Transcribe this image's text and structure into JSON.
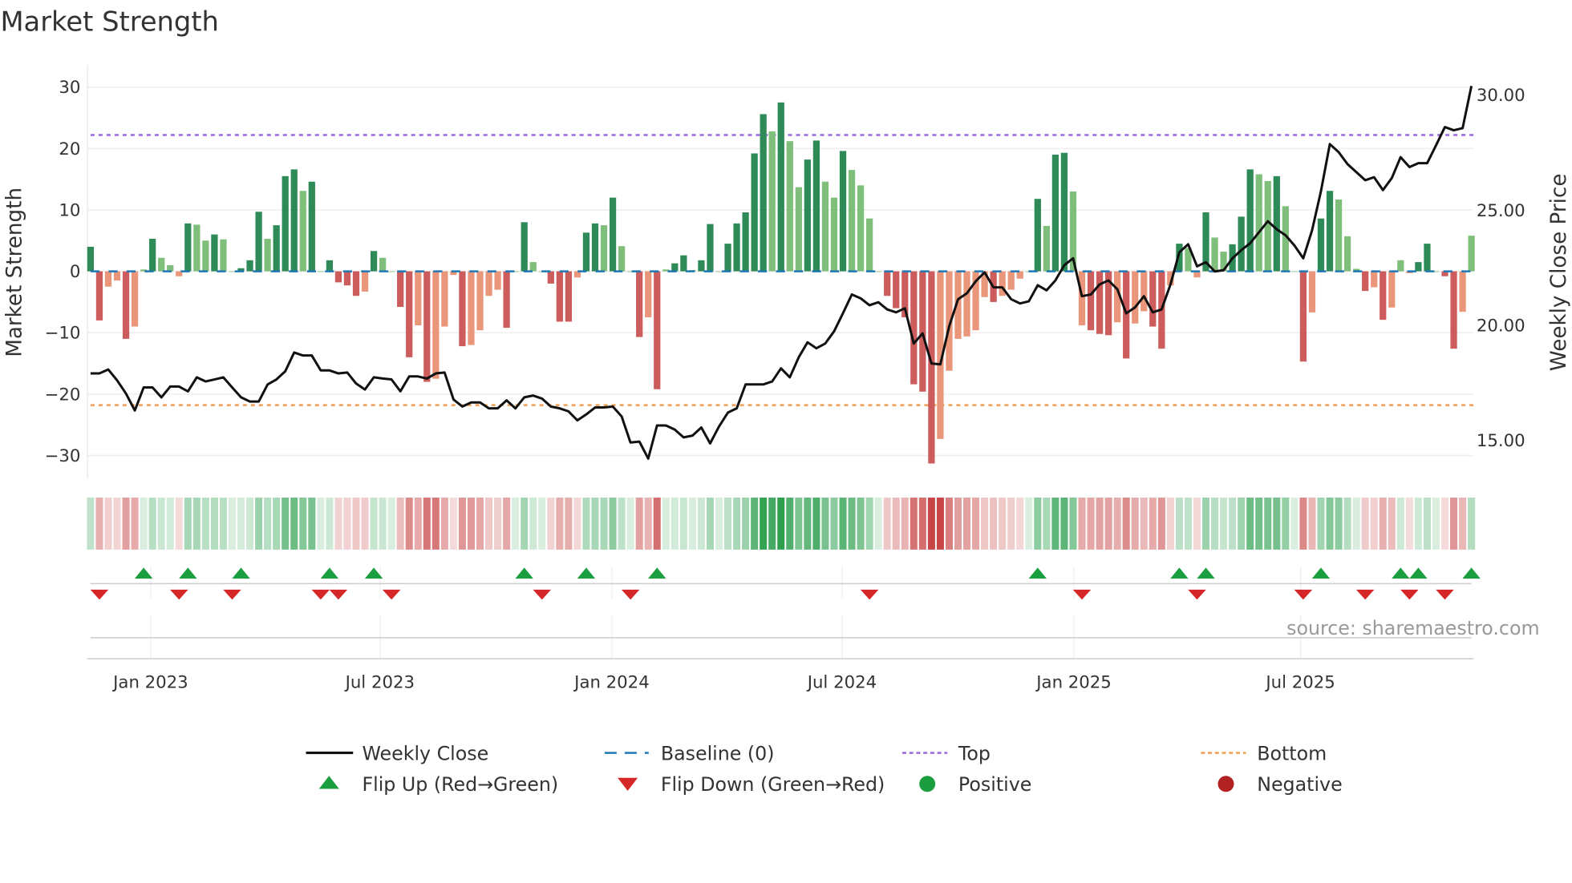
{
  "title": "Market Strength",
  "source": "source: sharemaestro.com",
  "colors": {
    "pos_strong": "#2e8b57",
    "pos_weak": "#7fbf7b",
    "neg_strong": "#cd5c5c",
    "neg_weak": "#e9967a",
    "price": "#111111",
    "baseline": "#1f77b4",
    "top": "#9966dd",
    "bottom": "#f0a050",
    "flip_up": "#1a9e3f",
    "flip_down": "#d62728"
  },
  "chart_data": {
    "type": "bar+line",
    "title": "Market Strength",
    "ylabel": "Market Strength",
    "y2label": "Weekly Close Price",
    "ylim": [
      -35,
      34
    ],
    "y2lim": [
      13.9,
      31.9
    ],
    "yticks": [
      30,
      20,
      10,
      0,
      -10,
      -20,
      -30
    ],
    "yticklabels": [
      "30",
      "20",
      "10",
      "0",
      "−10",
      "−20",
      "−30"
    ],
    "y2ticks": [
      30,
      25,
      20,
      15
    ],
    "y2ticklabels": [
      "30.00",
      "25.00",
      "20.00",
      "15.00"
    ],
    "xticks": [
      {
        "label": "Jan 2023",
        "week": 6.8
      },
      {
        "label": "Jul 2023",
        "week": 32.7
      },
      {
        "label": "Jan 2024",
        "week": 58.9
      },
      {
        "label": "Jul 2024",
        "week": 84.9
      },
      {
        "label": "Jan 2025",
        "week": 111.1
      },
      {
        "label": "Jul 2025",
        "week": 136.7
      }
    ],
    "top_level": 22.2,
    "bottom_level": -21.8,
    "baseline": 0,
    "strength": [
      4,
      -8,
      -2.5,
      -1.5,
      -11,
      -9,
      0.3,
      5.3,
      2.2,
      1,
      -0.8,
      7.8,
      7.6,
      5,
      6,
      5.2,
      0,
      0.5,
      1.8,
      9.7,
      5.3,
      7.5,
      15.5,
      16.6,
      13.1,
      14.6,
      0,
      1.8,
      -1.8,
      -2.3,
      -4,
      -3.3,
      3.3,
      2.2,
      0,
      -5.8,
      -14,
      -8.8,
      -18,
      -17.5,
      -9,
      -0.6,
      -12.2,
      -12,
      -9.6,
      -4,
      -3,
      -9.2,
      0,
      8,
      1.5,
      0,
      -2,
      -8.2,
      -8.2,
      -1,
      6.3,
      7.8,
      7.5,
      12,
      4.1,
      0,
      -10.7,
      -7.5,
      -19.2,
      0.3,
      1.3,
      2.6,
      0.2,
      1.8,
      7.7,
      0,
      4.5,
      7.8,
      9.6,
      19.2,
      25.6,
      22.8,
      27.5,
      21.2,
      13.7,
      18.2,
      21.3,
      14.6,
      12,
      19.6,
      16.5,
      14,
      8.6,
      0,
      -4,
      -6,
      -7.5,
      -18.4,
      -19.6,
      -31.3,
      -27.3,
      -16.2,
      -11,
      -10.6,
      -9.6,
      -4.2,
      -5,
      -4,
      -3,
      -1.2,
      0,
      11.8,
      7.4,
      19,
      19.3,
      13,
      -8.8,
      -9.6,
      -10.2,
      -10.4,
      -8.3,
      -14.2,
      -8.5,
      -6.5,
      -9,
      -12.6,
      -2.3,
      4.5,
      3.8,
      -1,
      9.6,
      5.5,
      3.2,
      4.4,
      8.9,
      16.6,
      15.8,
      14.7,
      15.5,
      10.6,
      0,
      -14.7,
      -6.7,
      8.6,
      13.1,
      11.7,
      5.7,
      0.4,
      -3.2,
      -2.6,
      -7.9,
      -5.9,
      1.8,
      -0.3,
      1.5,
      4.5,
      0,
      -0.8,
      -12.6,
      -6.6,
      5.8
    ],
    "weekly_close": [
      17.87,
      17.87,
      18.04,
      17.57,
      17.0,
      16.26,
      17.26,
      17.26,
      16.83,
      17.3,
      17.3,
      17.09,
      17.7,
      17.52,
      17.61,
      17.7,
      17.26,
      16.83,
      16.65,
      16.65,
      17.39,
      17.61,
      17.96,
      18.78,
      18.65,
      18.65,
      18.0,
      18.0,
      17.87,
      17.91,
      17.43,
      17.17,
      17.7,
      17.65,
      17.61,
      17.09,
      17.74,
      17.74,
      17.65,
      17.87,
      17.91,
      16.74,
      16.43,
      16.61,
      16.61,
      16.35,
      16.35,
      16.7,
      16.35,
      16.83,
      16.91,
      16.78,
      16.43,
      16.35,
      16.22,
      15.83,
      16.09,
      16.39,
      16.39,
      16.43,
      16.0,
      14.87,
      14.91,
      14.17,
      15.61,
      15.61,
      15.43,
      15.09,
      15.17,
      15.52,
      14.83,
      15.57,
      16.17,
      16.35,
      17.39,
      17.39,
      17.39,
      17.52,
      18.09,
      17.7,
      18.57,
      19.22,
      18.96,
      19.17,
      19.7,
      20.48,
      21.3,
      21.13,
      20.83,
      20.96,
      20.65,
      20.52,
      20.7,
      19.17,
      19.61,
      18.3,
      18.26,
      19.91,
      21.09,
      21.35,
      21.87,
      22.26,
      21.61,
      21.61,
      21.09,
      20.91,
      21.0,
      21.7,
      21.48,
      21.91,
      22.57,
      22.87,
      21.22,
      21.3,
      21.74,
      21.91,
      21.52,
      20.48,
      20.74,
      21.22,
      20.52,
      20.65,
      21.74,
      23.13,
      23.48,
      22.52,
      22.7,
      22.3,
      22.35,
      22.87,
      23.22,
      23.52,
      24.0,
      24.48,
      24.13,
      23.87,
      23.43,
      22.87,
      24.09,
      25.78,
      27.83,
      27.48,
      26.96,
      26.61,
      26.26,
      26.39,
      25.83,
      26.35,
      27.26,
      26.83,
      27.0,
      27.0,
      27.78,
      28.57,
      28.43,
      28.52,
      30.35
    ],
    "flip_up_weeks": [
      6,
      11,
      17,
      27,
      32,
      49,
      56,
      64,
      107,
      123,
      126,
      139,
      148,
      150,
      156
    ],
    "flip_down_weeks": [
      1,
      10,
      16,
      26,
      28,
      34,
      51,
      61,
      88,
      112,
      125,
      137,
      144,
      149,
      153
    ],
    "legend": {
      "placement": "bottom",
      "items": [
        {
          "label": "Weekly Close",
          "kind": "line"
        },
        {
          "label": "Baseline (0)",
          "kind": "dash"
        },
        {
          "label": "Top",
          "kind": "dot-purple"
        },
        {
          "label": "Bottom",
          "kind": "dot-orange"
        },
        {
          "label": "Flip Up (Red→Green)",
          "kind": "tri-up"
        },
        {
          "label": "Flip Down (Green→Red)",
          "kind": "tri-down"
        },
        {
          "label": "Positive",
          "kind": "circle-green"
        },
        {
          "label": "Negative",
          "kind": "circle-red"
        }
      ]
    }
  }
}
